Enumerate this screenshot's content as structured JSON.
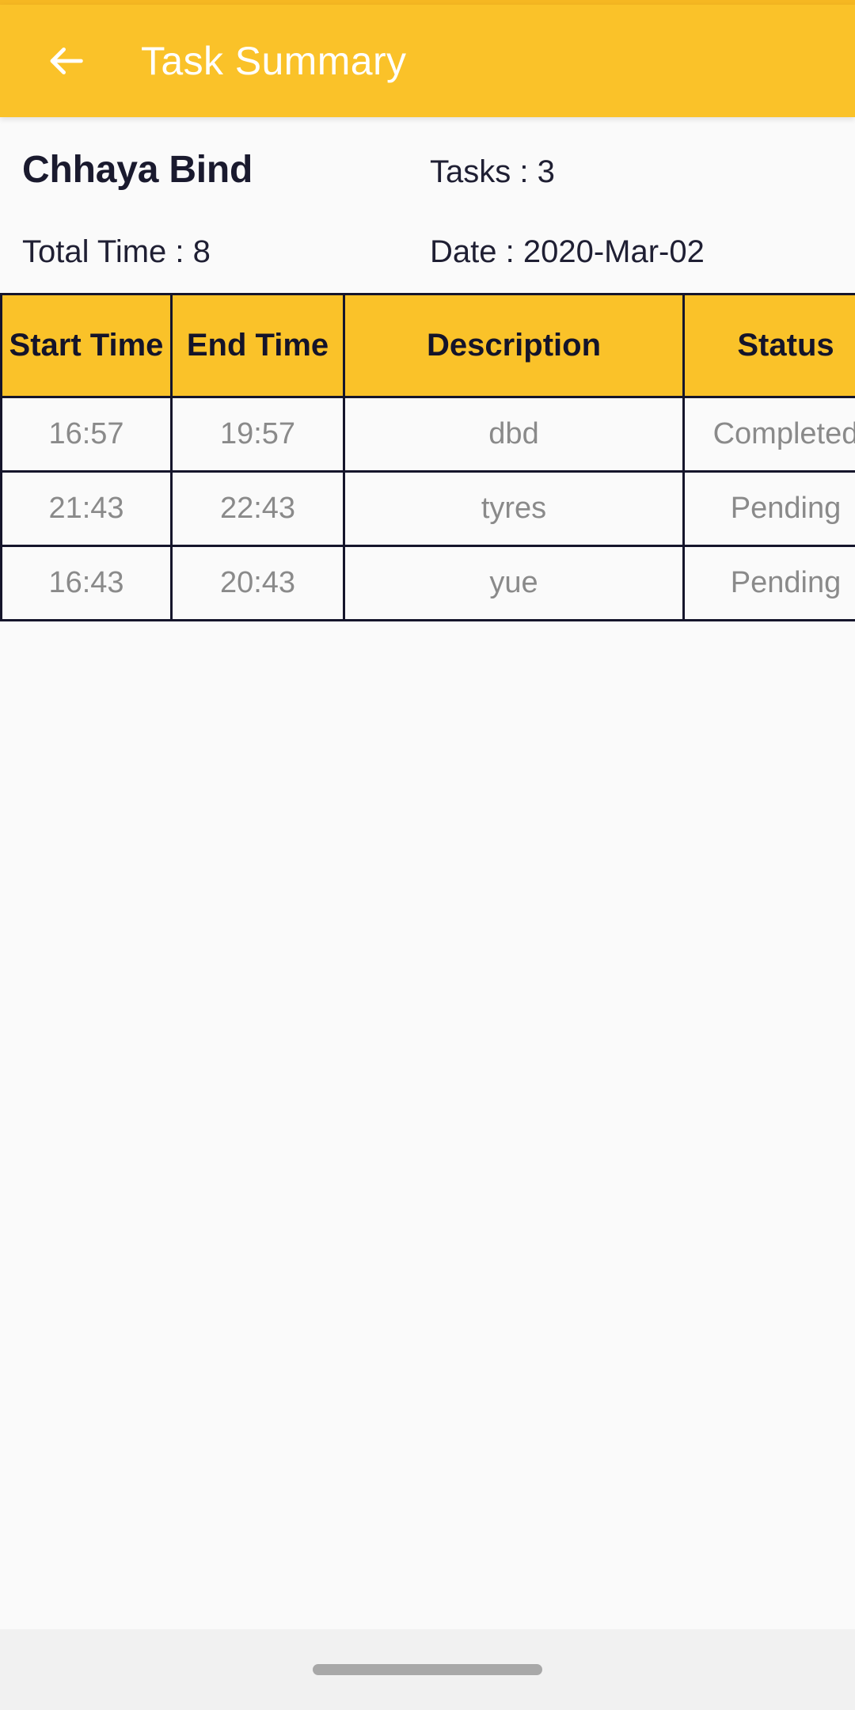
{
  "app_bar": {
    "title": "Task Summary",
    "back_icon": "arrow-left-icon",
    "background_color": "#FAC229",
    "title_color": "#FFFFFF"
  },
  "summary": {
    "user_name": "Chhaya Bind",
    "tasks_label": "Tasks : 3",
    "total_time_label": "Total Time : 8",
    "date_label": "Date : 2020-Mar-02"
  },
  "table": {
    "headers": [
      "Start Time",
      "End Time",
      "Description",
      "Status"
    ],
    "rows": [
      {
        "start_time": "16:57",
        "end_time": "19:57",
        "description": "dbd",
        "status": "Completed",
        "status_color": "#148A19"
      },
      {
        "start_time": "21:43",
        "end_time": "22:43",
        "description": "tyres",
        "status": "Pending",
        "status_color": "#E21B1B"
      },
      {
        "start_time": "16:43",
        "end_time": "20:43",
        "description": "yue",
        "status": "Pending",
        "status_color": "#E21B1B"
      }
    ]
  },
  "system_nav": {
    "gesture_pill": "home-gesture-pill"
  }
}
